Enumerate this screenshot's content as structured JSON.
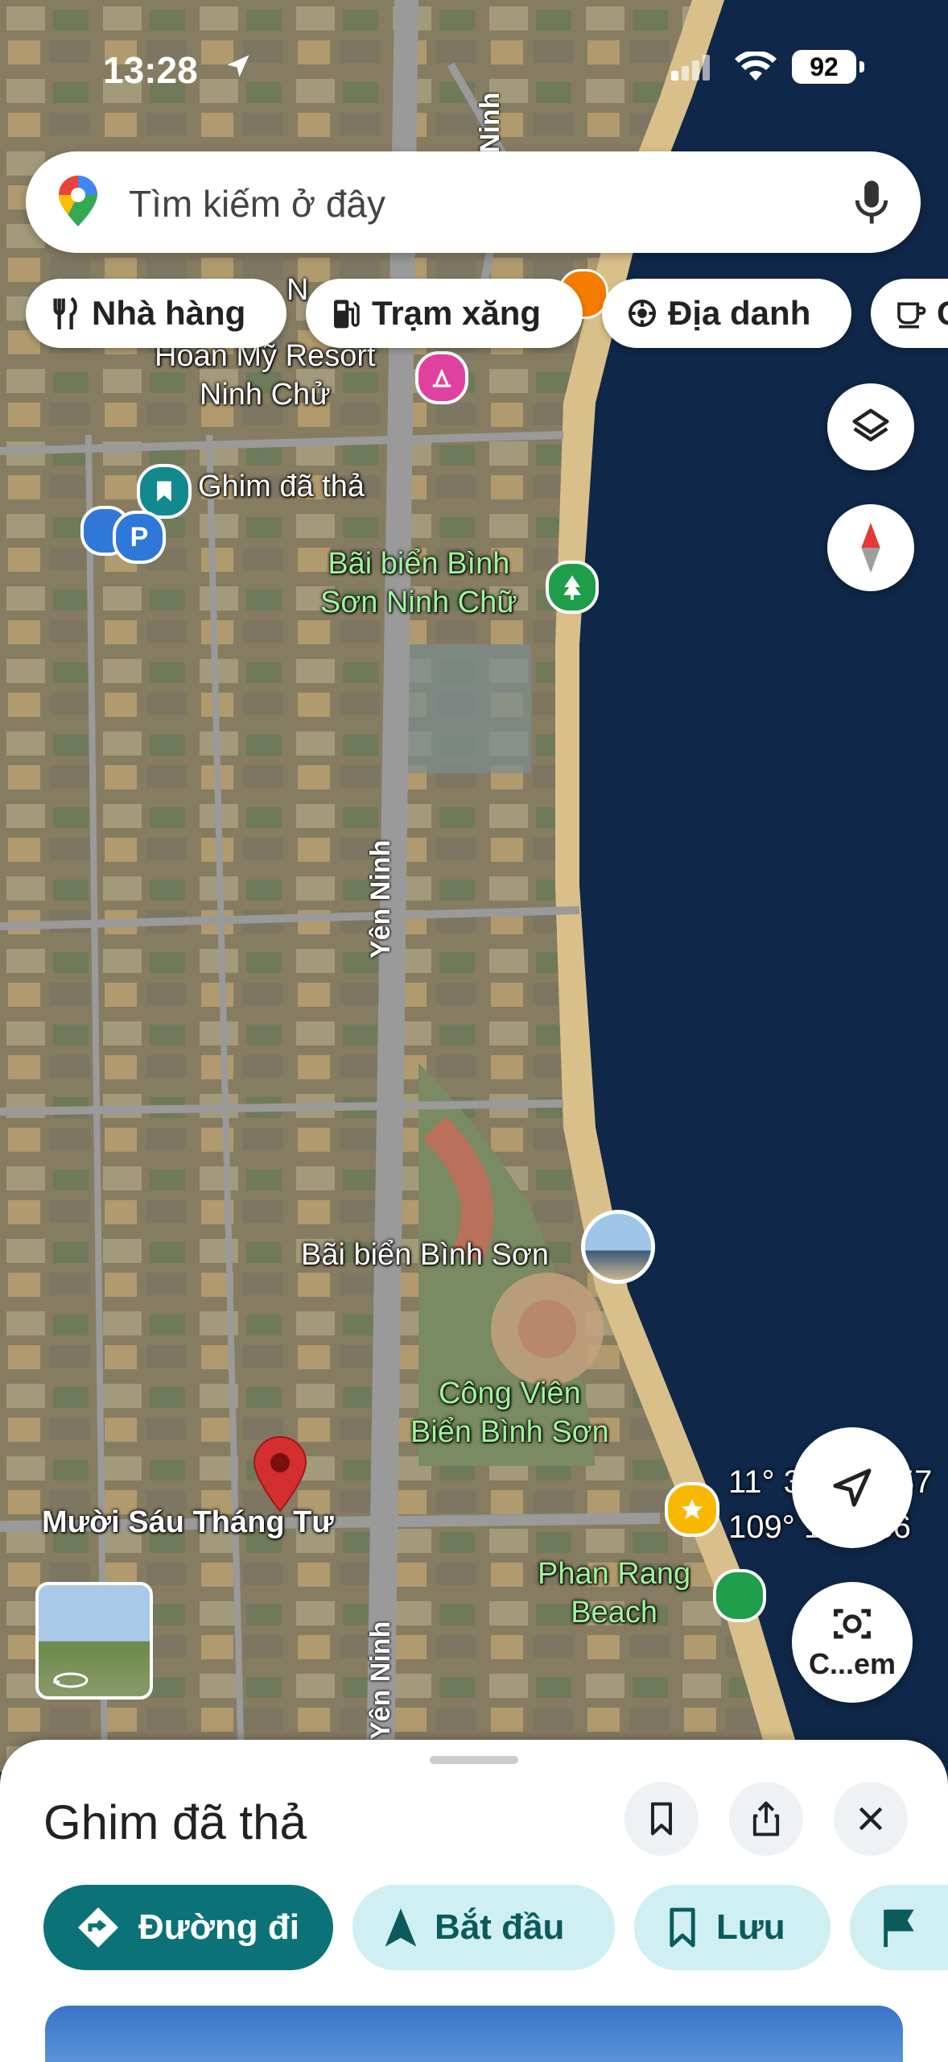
{
  "status_bar": {
    "time": "13:28",
    "battery": "92"
  },
  "search": {
    "placeholder": "Tìm kiếm ở đây"
  },
  "chips": [
    {
      "label": "Nhà hàng",
      "icon": "fork-knife-icon"
    },
    {
      "label": "Trạm xăng",
      "icon": "gas-station-icon"
    },
    {
      "label": "Địa danh",
      "icon": "landmark-icon"
    },
    {
      "label": "C",
      "icon": "coffee-icon"
    }
  ],
  "map": {
    "labels": {
      "resort": "Hoan Mỹ Resort\nNinh Chử",
      "dropped_pin": "Ghim đã thả",
      "beach_north": "Bãi biển Bình\nSơn Ninh Chữ",
      "road_yen_ninh": "Yên Ninh",
      "beach_binh_son": "Bãi biển Bình Sơn",
      "park": "Công Viên\nBiển Bình Sơn",
      "street": "Mười Sáu Tháng Tư",
      "phan_rang_beach": "Phan Rang\nBeach",
      "road_yen_ninh_south": "Yên Ninh",
      "partial_top": "N",
      "partial_road": "Ninh"
    },
    "coords": {
      "lat": "11° 3",
      "lat_end": "57",
      "lon": "109° 1",
      "lon_end": "936"
    },
    "camera_label": "C...em",
    "colors": {
      "sea": "#0f2748",
      "sand": "#d9c08a",
      "land": "#8a8068",
      "road": "#9a9a9a"
    }
  },
  "sheet": {
    "title": "Ghim đã thả",
    "actions": [
      {
        "label": "Đường đi",
        "icon": "directions-icon"
      },
      {
        "label": "Bắt đầu",
        "icon": "navigation-arrow-icon"
      },
      {
        "label": "Lưu",
        "icon": "bookmark-icon"
      },
      {
        "label": "",
        "icon": "flag-icon"
      }
    ]
  },
  "colors": {
    "primary": "#0b7377",
    "tonal": "#cfeff2",
    "pin_red": "#d32f2f"
  }
}
